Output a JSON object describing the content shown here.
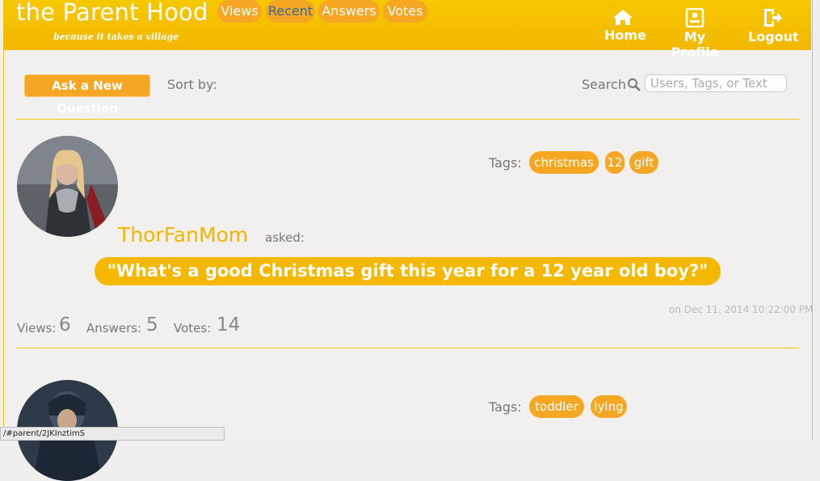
{
  "header": {
    "brand": "the Parent Hood",
    "tagline": "because it takes a village",
    "nav": [
      {
        "label": "Home",
        "icon": "home-icon"
      },
      {
        "label": "My Profile",
        "icon": "profile-icon"
      },
      {
        "label": "Logout",
        "icon": "logout-icon"
      }
    ]
  },
  "toolbar": {
    "ask_label": "Ask a New Question",
    "sort_label": "Sort by:",
    "sort_options": [
      "Views",
      "Recent",
      "Answers",
      "Votes"
    ],
    "active_sort": "Recent",
    "search_label": "Search",
    "search_placeholder": "Users, Tags, or Text"
  },
  "questions": [
    {
      "tags_label": "Tags:",
      "tags": [
        "christmas",
        "12",
        "gift"
      ],
      "author": "ThorFanMom",
      "asked": "asked:",
      "text": "\"What's a good Christmas gift this year for a 12 year old boy?\"",
      "timestamp": "on Dec 11, 2014 10:22:00 PM",
      "views_label": "Views:",
      "views": "6",
      "answers_label": "Answers:",
      "answers": "5",
      "votes_label": "Votes:",
      "votes": "14"
    },
    {
      "tags_label": "Tags:",
      "tags": [
        "toddler",
        "lying"
      ]
    }
  ],
  "status_url": "/#parent/2JKInztimS",
  "colors": {
    "header": "#f4be00",
    "accent_orange": "#f5a623",
    "author": "#f4b400",
    "background": "#f2f0ee"
  }
}
